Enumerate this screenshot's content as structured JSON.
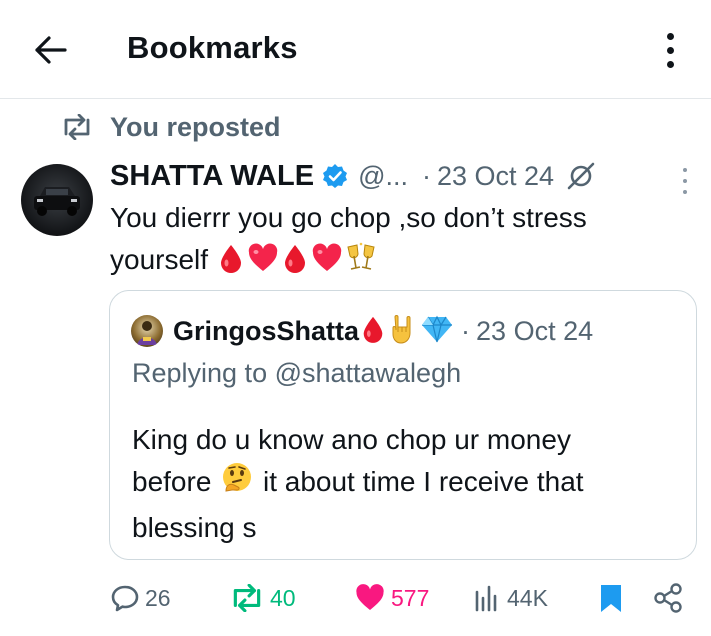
{
  "header": {
    "title": "Bookmarks"
  },
  "repost": {
    "label": "You reposted"
  },
  "tweet": {
    "name": "SHATTA WALE",
    "handle": "@...",
    "separator": "·",
    "date": "23 Oct 24",
    "text_line1": "You dierrr you go chop ,so don’t stress",
    "text_line2": "yourself"
  },
  "quote": {
    "name": "GringosShatta",
    "separator": "·",
    "date": "23 Oct 24",
    "replying_to": "Replying to @shattawalegh",
    "text_line1": "King do u know ano chop ur money",
    "text_line2a": "before",
    "text_line2b": "it about time I receive that",
    "text_line3": "blessing s"
  },
  "actions": {
    "replies": "26",
    "reposts": "40",
    "likes": "577",
    "views": "44K"
  },
  "colors": {
    "text": "#0f1419",
    "muted": "#536471",
    "verified": "#1d9bf0",
    "repost_active": "#00ba7c",
    "like_active": "#f91880",
    "bookmark_active": "#1d9bf0",
    "border": "#cfd9de"
  },
  "icons": {
    "back": "arrow-left-icon",
    "menu": "more-vertical-icon",
    "repost": "repost-icon",
    "verified": "verified-badge-icon",
    "grok": "grok-icon",
    "reply": "reply-bubble-icon",
    "like": "heart-icon",
    "views": "views-bars-icon",
    "bookmark": "bookmark-icon",
    "share": "share-icon"
  }
}
